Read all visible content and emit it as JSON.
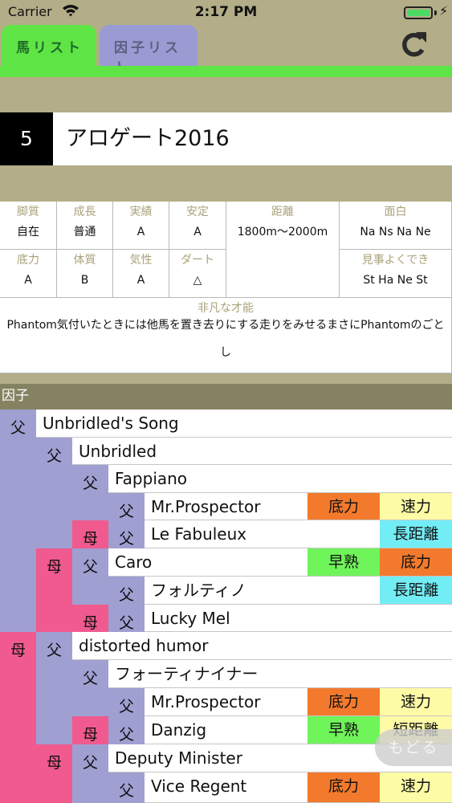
{
  "status": {
    "carrier": "Carrier",
    "time": "2:17 PM"
  },
  "tabs": {
    "horse": "馬リスト",
    "factor": "因子リスト"
  },
  "horse": {
    "number": "5",
    "name": "アロゲート2016"
  },
  "stats": {
    "leg": {
      "label": "脚質",
      "value": "自在"
    },
    "growth": {
      "label": "成長",
      "value": "普通"
    },
    "record": {
      "label": "実績",
      "value": "A"
    },
    "stability": {
      "label": "安定",
      "value": "A"
    },
    "distance": {
      "label": "距離",
      "value": "1800m〜2000m"
    },
    "fun": {
      "label": "面白",
      "value": "Na Ns Na Ne"
    },
    "stamina": {
      "label": "底力",
      "value": "A"
    },
    "body": {
      "label": "体質",
      "value": "B"
    },
    "temper": {
      "label": "気性",
      "value": "A"
    },
    "dirt": {
      "label": "ダート",
      "value": "△"
    },
    "highlight": {
      "label": "見事よくでき",
      "value": "St Ha Ne St"
    },
    "talent": {
      "label": "非凡な才能",
      "value": "Phantom気付いたときには他馬を置き去りにする走りをみせるまさにPhantomのごとし"
    }
  },
  "factor_header": "因子",
  "pedigree": {
    "father_label": "父",
    "mother_label": "母",
    "rows": [
      {
        "name": "Unbridled's Song",
        "tags": []
      },
      {
        "name": "Unbridled",
        "tags": []
      },
      {
        "name": "Fappiano",
        "tags": []
      },
      {
        "name": "Mr.Prospector",
        "tags": [
          "底力",
          "速力"
        ]
      },
      {
        "name": "Le Fabuleux",
        "tags": [
          "長距離"
        ]
      },
      {
        "name": "Caro",
        "tags": [
          "早熟",
          "底力"
        ]
      },
      {
        "name": "フォルティノ",
        "tags": [
          "長距離"
        ]
      },
      {
        "name": "Lucky Mel",
        "tags": []
      },
      {
        "name": "distorted humor",
        "tags": []
      },
      {
        "name": "フォーティナイナー",
        "tags": []
      },
      {
        "name": "Mr.Prospector",
        "tags": [
          "底力",
          "速力"
        ]
      },
      {
        "name": "Danzig",
        "tags": [
          "早熟",
          "短距離"
        ]
      },
      {
        "name": "Deputy Minister",
        "tags": []
      },
      {
        "name": "Vice Regent",
        "tags": [
          "底力",
          "速力"
        ]
      }
    ]
  },
  "back_button": "もどる",
  "colors": {
    "tab_green": "#5fe445",
    "father": "#9f9fd2",
    "mother": "#f05a8e",
    "stamina_tag": "#f37a2c",
    "speed_tag": "#fefba6",
    "distance_tag": "#73edf5",
    "early_tag": "#6ff45a"
  },
  "icons": {
    "refresh": "refresh-icon",
    "wifi": "wifi-icon",
    "battery": "battery-icon"
  }
}
